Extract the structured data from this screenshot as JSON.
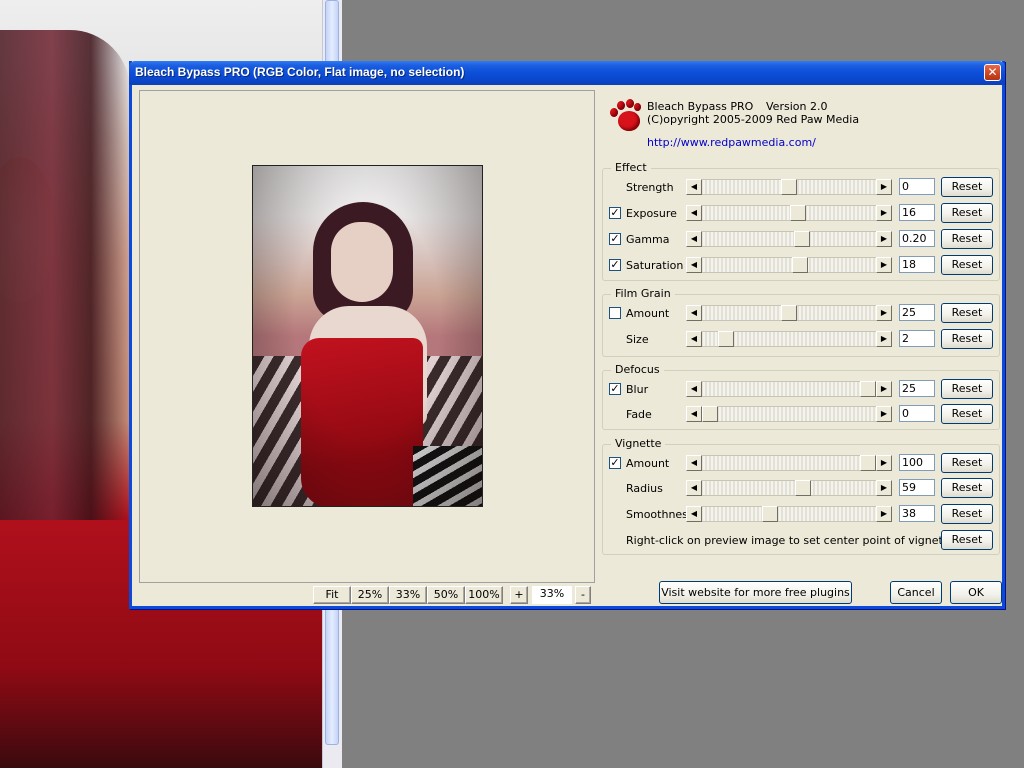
{
  "dialog": {
    "title": "Bleach Bypass PRO (RGB Color, Flat image, no selection)",
    "close_glyph": "✕"
  },
  "header": {
    "product": "Bleach Bypass PRO",
    "version": "Version 2.0",
    "copyright": "(C)opyright 2005-2009 Red Paw Media",
    "url": "http://www.redpawmedia.com/"
  },
  "zoom": {
    "buttons": [
      "Fit",
      "25%",
      "33%",
      "50%",
      "100%"
    ],
    "plus": "+",
    "minus": "-",
    "value": "33%"
  },
  "groups": {
    "effect": {
      "title": "Effect",
      "rows": [
        {
          "label": "Strength",
          "has_checkbox": false,
          "checked": false,
          "value": "0",
          "level": 0.5
        },
        {
          "label": "Exposure",
          "has_checkbox": true,
          "checked": true,
          "value": "16",
          "level": 0.56
        },
        {
          "label": "Gamma",
          "has_checkbox": true,
          "checked": true,
          "value": "0.20",
          "level": 0.58
        },
        {
          "label": "Saturation",
          "has_checkbox": true,
          "checked": true,
          "value": "18",
          "level": 0.57
        }
      ]
    },
    "film_grain": {
      "title": "Film Grain",
      "rows": [
        {
          "label": "Amount",
          "has_checkbox": true,
          "checked": false,
          "value": "25",
          "level": 0.5
        },
        {
          "label": "Size",
          "has_checkbox": false,
          "checked": false,
          "value": "2",
          "level": 0.1
        }
      ]
    },
    "defocus": {
      "title": "Defocus",
      "rows": [
        {
          "label": "Blur",
          "has_checkbox": true,
          "checked": true,
          "value": "25",
          "level": 1.0
        },
        {
          "label": "Fade",
          "has_checkbox": false,
          "checked": false,
          "value": "0",
          "level": 0.0
        }
      ]
    },
    "vignette": {
      "title": "Vignette",
      "rows": [
        {
          "label": "Amount",
          "has_checkbox": true,
          "checked": true,
          "value": "100",
          "level": 1.0
        },
        {
          "label": "Radius",
          "has_checkbox": false,
          "checked": false,
          "value": "59",
          "level": 0.59
        },
        {
          "label": "Smoothness",
          "has_checkbox": false,
          "checked": false,
          "value": "38",
          "level": 0.38
        }
      ],
      "note": "Right-click on preview image to set center point of vignette"
    }
  },
  "reset_label": "Reset",
  "checkmark": "✓",
  "arrow_left": "◀",
  "arrow_right": "▶",
  "footer": {
    "visit": "Visit website for more free plugins",
    "cancel": "Cancel",
    "ok": "OK"
  }
}
